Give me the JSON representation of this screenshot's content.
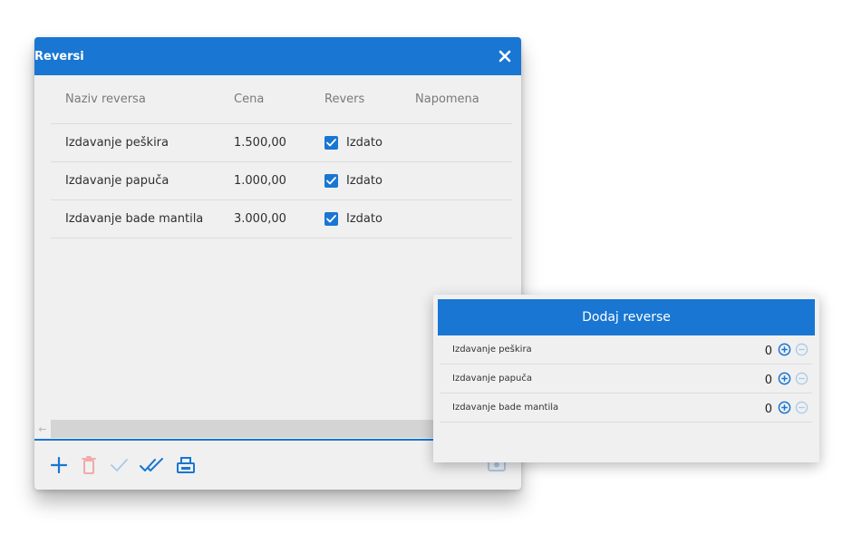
{
  "dialog": {
    "title": "Reversi",
    "columns": [
      "Naziv reversa",
      "Cena",
      "Revers",
      "Napomena"
    ],
    "rows": [
      {
        "name": "Izdavanje peškira",
        "price": "1.500,00",
        "status": "Izdato",
        "checked": true,
        "note": ""
      },
      {
        "name": "Izdavanje papuča",
        "price": "1.000,00",
        "status": "Izdato",
        "checked": true,
        "note": ""
      },
      {
        "name": "Izdavanje bade mantila",
        "price": "3.000,00",
        "status": "Izdato",
        "checked": true,
        "note": ""
      }
    ],
    "toolbar": {
      "icons": [
        "plus-icon",
        "trash-icon",
        "check-icon",
        "double-check-icon",
        "print-icon",
        "camera-icon"
      ]
    }
  },
  "popup": {
    "title": "Dodaj reverse",
    "items": [
      {
        "name": "Izdavanje peškira",
        "qty": "0"
      },
      {
        "name": "Izdavanje papuča",
        "qty": "0"
      },
      {
        "name": "Izdavanje bade mantila",
        "qty": "0"
      }
    ]
  },
  "colors": {
    "accent": "#1976d2",
    "panel_bg": "#f0f0f0",
    "danger_light": "#f2a0a0",
    "disabled_blue": "#a9c9ea"
  }
}
